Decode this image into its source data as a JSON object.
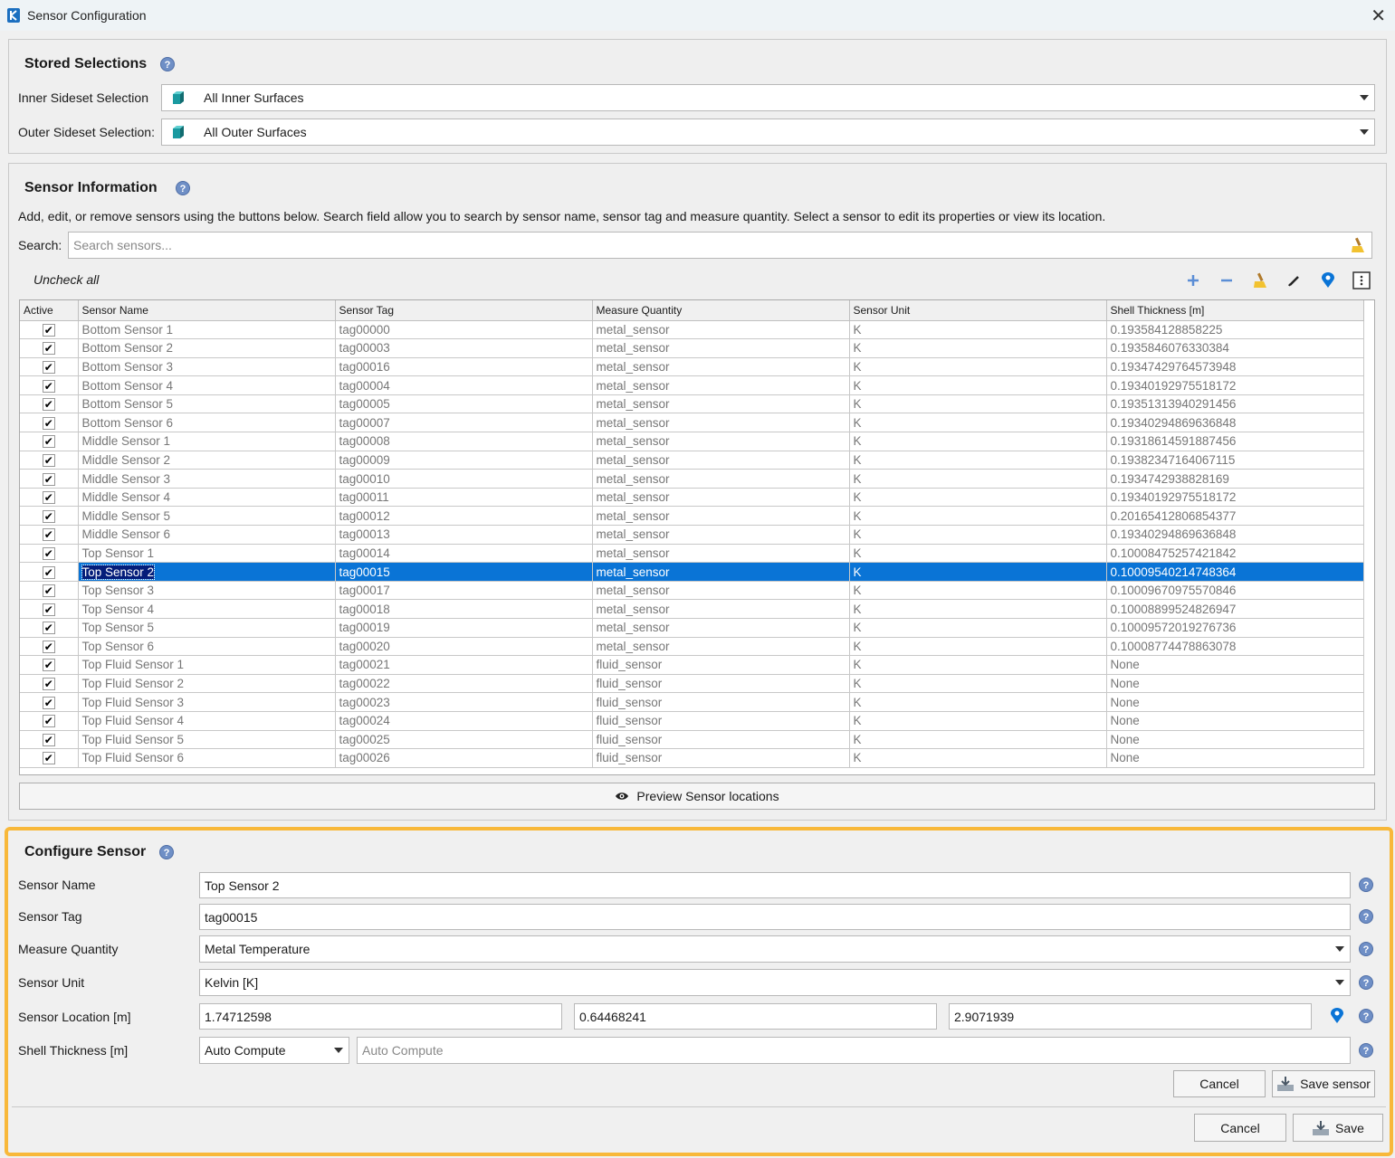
{
  "window": {
    "title": "Sensor Configuration",
    "close_label": "✕"
  },
  "stored": {
    "title": "Stored Selections",
    "help": "?",
    "inner_label": "Inner Sideset Selection",
    "inner_value": "All Inner Surfaces",
    "outer_label": "Outer Sideset Selection:",
    "outer_value": "All Outer Surfaces"
  },
  "info": {
    "title": "Sensor Information",
    "help": "?",
    "description": "Add, edit, or remove sensors using the buttons below. Search field allow you to search by sensor name, sensor tag and measure quantity. Select a sensor to edit its properties or view its location.",
    "search_label": "Search:",
    "search_placeholder": "Search sensors...",
    "uncheck_all": "Uncheck all",
    "toolbar_icons": [
      "plus-icon",
      "minus-icon",
      "broom-icon",
      "pencil-icon",
      "location-pin-icon",
      "more-vertical-icon"
    ],
    "preview_label": "Preview Sensor locations"
  },
  "table": {
    "columns": [
      "Active",
      "Sensor Name",
      "Sensor Tag",
      "Measure Quantity",
      "Sensor Unit",
      "Shell Thickness [m]"
    ],
    "selected_index": 13,
    "rows": [
      {
        "active": "✔",
        "name": "Bottom Sensor 1",
        "tag": "tag00000",
        "quantity": "metal_sensor",
        "unit": "K",
        "thickness": "0.193584128858225"
      },
      {
        "active": "✔",
        "name": "Bottom Sensor 2",
        "tag": "tag00003",
        "quantity": "metal_sensor",
        "unit": "K",
        "thickness": "0.1935846076330384"
      },
      {
        "active": "✔",
        "name": "Bottom Sensor 3",
        "tag": "tag00016",
        "quantity": "metal_sensor",
        "unit": "K",
        "thickness": "0.19347429764573948"
      },
      {
        "active": "✔",
        "name": "Bottom Sensor 4",
        "tag": "tag00004",
        "quantity": "metal_sensor",
        "unit": "K",
        "thickness": "0.19340192975518172"
      },
      {
        "active": "✔",
        "name": "Bottom Sensor 5",
        "tag": "tag00005",
        "quantity": "metal_sensor",
        "unit": "K",
        "thickness": "0.19351313940291456"
      },
      {
        "active": "✔",
        "name": "Bottom Sensor 6",
        "tag": "tag00007",
        "quantity": "metal_sensor",
        "unit": "K",
        "thickness": "0.19340294869636848"
      },
      {
        "active": "✔",
        "name": "Middle Sensor 1",
        "tag": "tag00008",
        "quantity": "metal_sensor",
        "unit": "K",
        "thickness": "0.19318614591887456"
      },
      {
        "active": "✔",
        "name": "Middle Sensor 2",
        "tag": "tag00009",
        "quantity": "metal_sensor",
        "unit": "K",
        "thickness": "0.19382347164067115"
      },
      {
        "active": "✔",
        "name": "Middle Sensor 3",
        "tag": "tag00010",
        "quantity": "metal_sensor",
        "unit": "K",
        "thickness": "0.1934742938828169"
      },
      {
        "active": "✔",
        "name": "Middle Sensor 4",
        "tag": "tag00011",
        "quantity": "metal_sensor",
        "unit": "K",
        "thickness": "0.19340192975518172"
      },
      {
        "active": "✔",
        "name": "Middle Sensor 5",
        "tag": "tag00012",
        "quantity": "metal_sensor",
        "unit": "K",
        "thickness": "0.20165412806854377"
      },
      {
        "active": "✔",
        "name": "Middle Sensor 6",
        "tag": "tag00013",
        "quantity": "metal_sensor",
        "unit": "K",
        "thickness": "0.19340294869636848"
      },
      {
        "active": "✔",
        "name": "Top Sensor 1",
        "tag": "tag00014",
        "quantity": "metal_sensor",
        "unit": "K",
        "thickness": "0.10008475257421842"
      },
      {
        "active": "✔",
        "name": "Top Sensor 2",
        "tag": "tag00015",
        "quantity": "metal_sensor",
        "unit": "K",
        "thickness": "0.10009540214748364"
      },
      {
        "active": "✔",
        "name": "Top Sensor 3",
        "tag": "tag00017",
        "quantity": "metal_sensor",
        "unit": "K",
        "thickness": "0.10009670975570846"
      },
      {
        "active": "✔",
        "name": "Top Sensor 4",
        "tag": "tag00018",
        "quantity": "metal_sensor",
        "unit": "K",
        "thickness": "0.10008899524826947"
      },
      {
        "active": "✔",
        "name": "Top Sensor 5",
        "tag": "tag00019",
        "quantity": "metal_sensor",
        "unit": "K",
        "thickness": "0.10009572019276736"
      },
      {
        "active": "✔",
        "name": "Top Sensor 6",
        "tag": "tag00020",
        "quantity": "metal_sensor",
        "unit": "K",
        "thickness": "0.10008774478863078"
      },
      {
        "active": "✔",
        "name": "Top Fluid Sensor 1",
        "tag": "tag00021",
        "quantity": "fluid_sensor",
        "unit": "K",
        "thickness": "None"
      },
      {
        "active": "✔",
        "name": "Top Fluid Sensor 2",
        "tag": "tag00022",
        "quantity": "fluid_sensor",
        "unit": "K",
        "thickness": "None"
      },
      {
        "active": "✔",
        "name": "Top Fluid Sensor 3",
        "tag": "tag00023",
        "quantity": "fluid_sensor",
        "unit": "K",
        "thickness": "None"
      },
      {
        "active": "✔",
        "name": "Top Fluid Sensor 4",
        "tag": "tag00024",
        "quantity": "fluid_sensor",
        "unit": "K",
        "thickness": "None"
      },
      {
        "active": "✔",
        "name": "Top Fluid Sensor 5",
        "tag": "tag00025",
        "quantity": "fluid_sensor",
        "unit": "K",
        "thickness": "None"
      },
      {
        "active": "✔",
        "name": "Top Fluid Sensor 6",
        "tag": "tag00026",
        "quantity": "fluid_sensor",
        "unit": "K",
        "thickness": "None"
      }
    ]
  },
  "configure": {
    "title": "Configure Sensor",
    "help": "?",
    "name_label": "Sensor Name",
    "name_value": "Top Sensor 2",
    "tag_label": "Sensor Tag",
    "tag_value": "tag00015",
    "quantity_label": "Measure Quantity",
    "quantity_value": "Metal Temperature",
    "unit_label": "Sensor Unit",
    "unit_value": "Kelvin [K]",
    "location_label": "Sensor Location [m]",
    "location_x": "1.74712598",
    "location_y": "0.64468241",
    "location_z": "2.9071939",
    "thickness_label": "Shell Thickness [m]",
    "thickness_mode": "Auto Compute",
    "thickness_placeholder": "Auto Compute",
    "cancel_sensor": "Cancel",
    "save_sensor": "Save sensor"
  },
  "footer": {
    "cancel": "Cancel",
    "save": "Save"
  },
  "colors": {
    "selection": "#0a74d6",
    "highlight_border": "#f8b83a",
    "help_icon": "#6f8fc6"
  }
}
